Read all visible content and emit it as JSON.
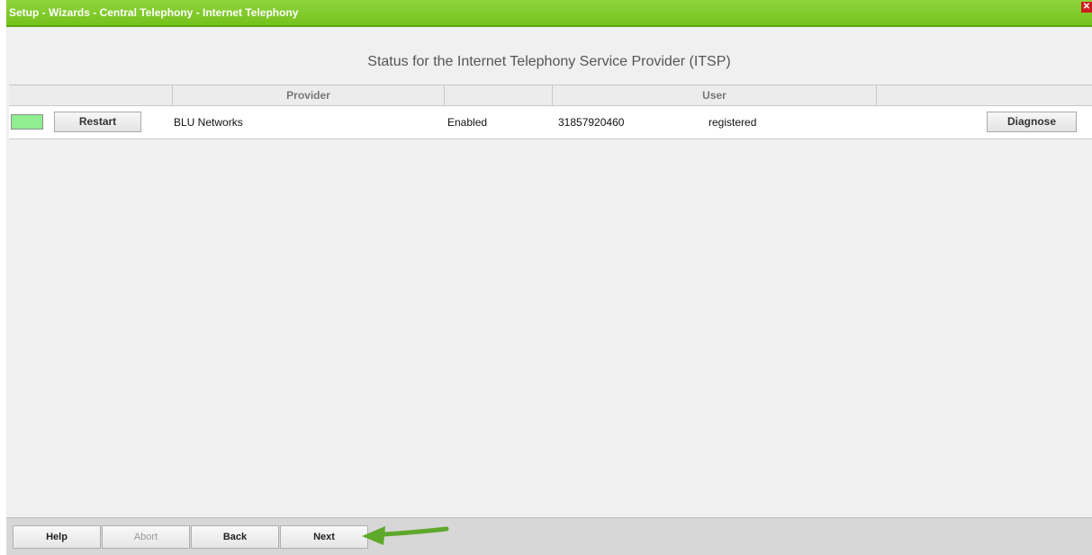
{
  "window": {
    "title": "Setup - Wizards - Central Telephony - Internet Telephony",
    "close_icon": "close-icon",
    "close_glyph": "✕"
  },
  "heading": "Status for the Internet Telephony Service Provider (ITSP)",
  "table": {
    "headers": [
      "",
      "Provider",
      "",
      "User",
      ""
    ],
    "rows": [
      {
        "status_color": "#90ee90",
        "restart_label": "Restart",
        "provider": "BLU Networks",
        "state": "Enabled",
        "user": "31857920460",
        "registration": "registered",
        "diagnose_label": "Diagnose"
      }
    ]
  },
  "footer": {
    "help_label": "Help",
    "abort_label": "Abort",
    "back_label": "Back",
    "next_label": "Next"
  },
  "colors": {
    "titlebar": "#7cc726",
    "accent_arrow": "#5ea82b",
    "status_ok": "#90ee90"
  }
}
